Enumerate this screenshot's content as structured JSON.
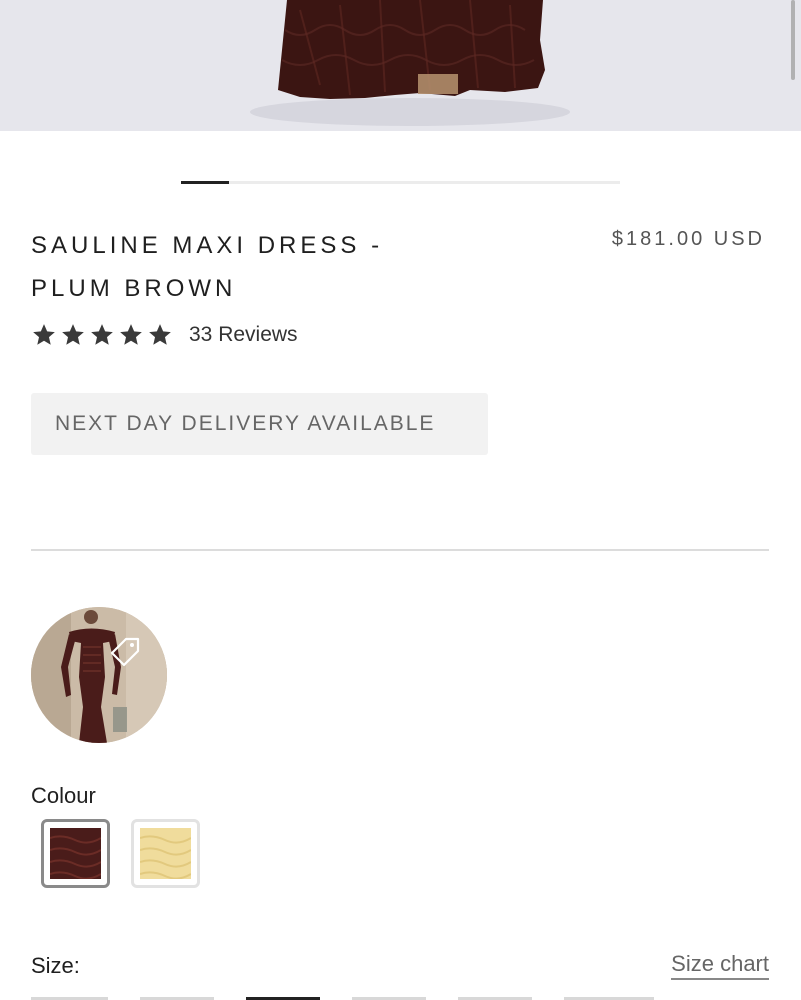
{
  "product": {
    "title_line1": "SAULINE MAXI DRESS -",
    "title_line2": "PLUM BROWN",
    "price": "$181.00 USD",
    "rating": 5,
    "reviews_label": "33 Reviews",
    "delivery_badge": "NEXT DAY DELIVERY AVAILABLE"
  },
  "carousel": {
    "progress": 0.11
  },
  "colour": {
    "label": "Colour",
    "options": [
      {
        "name": "plum-brown",
        "color": "#4a1c1a",
        "selected": true
      },
      {
        "name": "butter-yellow",
        "color": "#f0dc9c",
        "selected": false
      }
    ]
  },
  "size": {
    "label": "Size:",
    "chart_link": "Size chart"
  },
  "colors": {
    "dress": "#3b1512",
    "hero_bg": "#e6e6ec",
    "text": "#1f1f1f",
    "muted": "#666666"
  }
}
